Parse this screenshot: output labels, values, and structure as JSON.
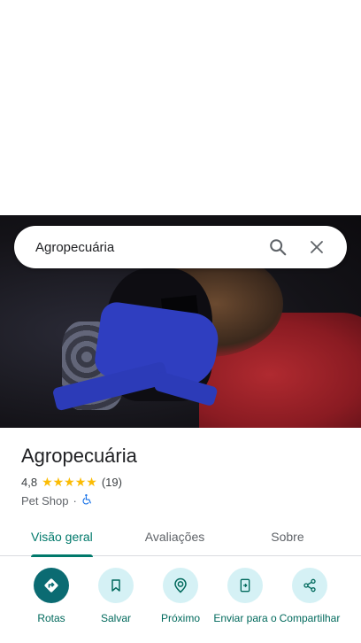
{
  "search": {
    "query": "Agropecuária"
  },
  "place": {
    "name": "Agropecuária",
    "rating": "4,8",
    "stars": "★★★★★",
    "review_count": "(19)",
    "category": "Pet Shop",
    "separator": "·",
    "accessibility_icon": "wheelchair-icon"
  },
  "tabs": [
    {
      "label": "Visão geral",
      "active": true
    },
    {
      "label": "Avaliações",
      "active": false
    },
    {
      "label": "Sobre",
      "active": false
    }
  ],
  "actions": [
    {
      "label": "Rotas",
      "icon": "directions-icon"
    },
    {
      "label": "Salvar",
      "icon": "bookmark-icon"
    },
    {
      "label": "Próximo",
      "icon": "nearby-icon"
    },
    {
      "label": "Enviar para o",
      "icon": "send-to-phone-icon"
    },
    {
      "label": "Compartilhar",
      "icon": "share-icon"
    }
  ],
  "colors": {
    "accent": "#00796b",
    "action_bg": "#d5f1f5",
    "primary_action_bg": "#0b6b72",
    "star": "#fbbc04"
  }
}
